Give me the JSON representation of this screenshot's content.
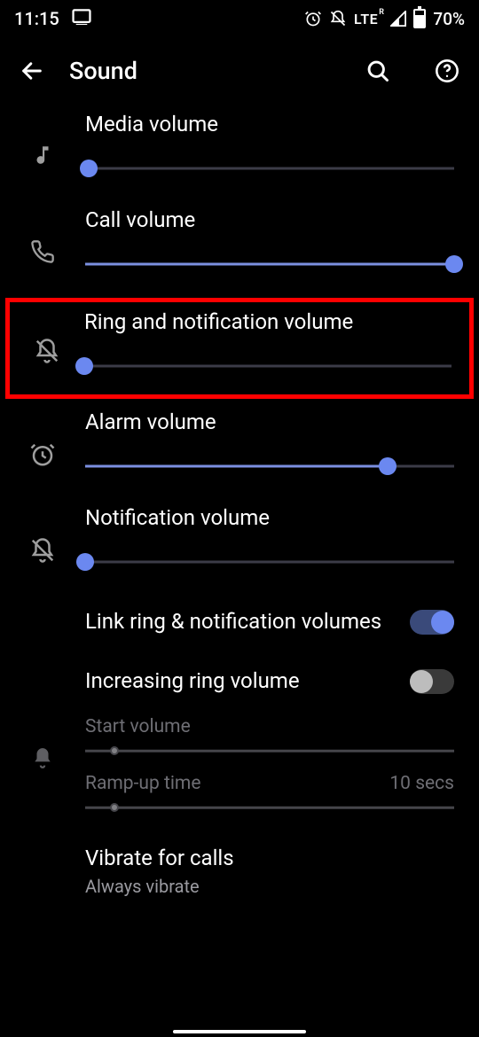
{
  "status": {
    "time": "11:15",
    "battery_pct": "70%",
    "network": "LTE",
    "network_sup": "R"
  },
  "appbar": {
    "title": "Sound"
  },
  "sliders": {
    "media": {
      "label": "Media volume",
      "value": 1,
      "max": 100
    },
    "call": {
      "label": "Call volume",
      "value": 100,
      "max": 100
    },
    "ring": {
      "label": "Ring and notification volume",
      "value": 0,
      "max": 100
    },
    "alarm": {
      "label": "Alarm volume",
      "value": 82,
      "max": 100
    },
    "notif": {
      "label": "Notification volume",
      "value": 0,
      "max": 100
    }
  },
  "toggles": {
    "link": {
      "label": "Link ring & notification volumes",
      "on": true
    },
    "increasing": {
      "label": "Increasing ring volume",
      "on": false
    }
  },
  "sub": {
    "start": {
      "label": "Start volume",
      "value": 8,
      "max": 100
    },
    "ramp": {
      "label": "Ramp-up time",
      "value": 8,
      "max": 100,
      "right": "10 secs"
    }
  },
  "vibrate": {
    "title": "Vibrate for calls",
    "subtitle": "Always vibrate"
  }
}
